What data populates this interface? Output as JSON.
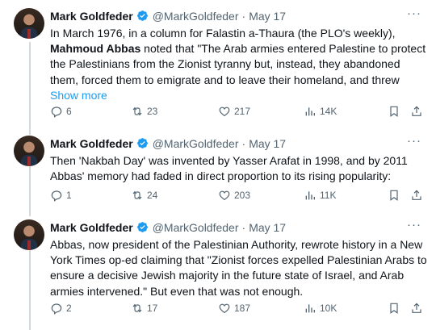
{
  "tweets": [
    {
      "author": "Mark Goldfeder",
      "handle": "@MarkGoldfeder",
      "date": "May 17",
      "text_a": "In March 1976, in a column for Falastin a-Thaura (the PLO's weekly),",
      "text_bold": "Mahmoud Abbas",
      "text_b": " noted that \"The Arab armies entered Palestine to protect the Palestinians from the Zionist tyranny but, instead, they abandoned them, forced them to emigrate and to leave their homeland, and threw",
      "show_more": "Show more",
      "replies": "6",
      "retweets": "23",
      "likes": "217",
      "views": "14K"
    },
    {
      "author": "Mark Goldfeder",
      "handle": "@MarkGoldfeder",
      "date": "May 17",
      "text": "Then 'Nakbah Day' was invented by Yasser Arafat in 1998, and by 2011 Abbas' memory had faded in direct proportion to its rising popularity:",
      "replies": "1",
      "retweets": "24",
      "likes": "203",
      "views": "11K"
    },
    {
      "author": "Mark Goldfeder",
      "handle": "@MarkGoldfeder",
      "date": "May 17",
      "text": "Abbas, now president of the Palestinian Authority, rewrote history in a New York Times op-ed claiming that \"Zionist forces expelled Palestinian Arabs to ensure a decisive Jewish majority in the future state of Israel, and Arab armies intervened.\" But even that was not enough.",
      "replies": "2",
      "retweets": "17",
      "likes": "187",
      "views": "10K"
    }
  ],
  "ui": {
    "more_glyph": "···",
    "separator": "·"
  },
  "colors": {
    "accent": "#1d9bf0",
    "muted": "#536471",
    "text": "#0f1419",
    "thread_line": "#cfd9de"
  }
}
